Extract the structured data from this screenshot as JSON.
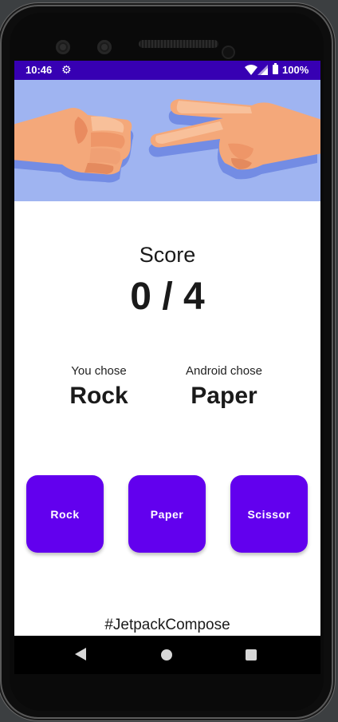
{
  "status_bar": {
    "time": "10:46",
    "battery_text": "100%",
    "icons": [
      "settings-icon",
      "wifi-icon",
      "signal-icon",
      "battery-icon"
    ]
  },
  "hero": {
    "icons": [
      "fist-rock-hand-icon",
      "scissors-hand-icon"
    ]
  },
  "score": {
    "label": "Score",
    "value": "0 / 4"
  },
  "player": {
    "caption": "You chose",
    "choice": "Rock"
  },
  "android": {
    "caption": "Android chose",
    "choice": "Paper"
  },
  "buttons": {
    "rock": "Rock",
    "paper": "Paper",
    "scissor": "Scissor"
  },
  "footer": {
    "tag": "#JetpackCompose"
  },
  "nav": {
    "icons": [
      "back-icon",
      "home-icon",
      "recents-icon"
    ]
  },
  "colors": {
    "status_bar": "#3700b3",
    "button": "#6200ee",
    "hero_background": "#9fb4f1"
  }
}
